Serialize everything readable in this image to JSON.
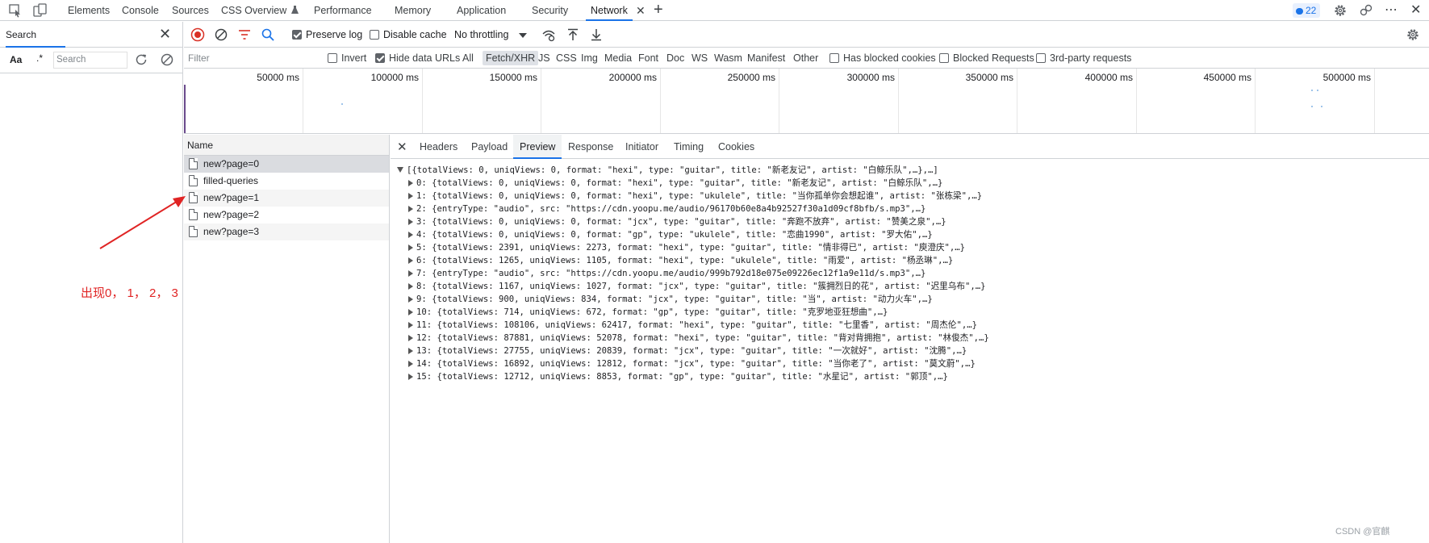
{
  "tabs": {
    "elements": "Elements",
    "console": "Console",
    "sources": "Sources",
    "css_overview": "CSS Overview",
    "css_overview_icon": "flask-icon",
    "performance": "Performance",
    "memory": "Memory",
    "application": "Application",
    "security": "Security",
    "network": "Network",
    "active": "Network",
    "issues_count": "22"
  },
  "search_drawer": {
    "title": "Search",
    "placeholder": "Search",
    "match_case_label": "Aa",
    "regex_label": ".*"
  },
  "toolbar": {
    "preserve_log": "Preserve log",
    "preserve_log_checked": true,
    "disable_cache": "Disable cache",
    "disable_cache_checked": false,
    "throttling": "No throttling"
  },
  "filter": {
    "placeholder": "Filter",
    "invert": "Invert",
    "hide_data_urls": "Hide data URLs",
    "hide_data_urls_checked": true,
    "types": [
      "All",
      "Fetch/XHR",
      "JS",
      "CSS",
      "Img",
      "Media",
      "Font",
      "Doc",
      "WS",
      "Wasm",
      "Manifest",
      "Other"
    ],
    "active_type": "Fetch/XHR",
    "blocked_cookies": "Has blocked cookies",
    "blocked_requests": "Blocked Requests",
    "third_party": "3rd-party requests"
  },
  "timeline": {
    "labels": [
      "50000 ms",
      "100000 ms",
      "150000 ms",
      "200000 ms",
      "250000 ms",
      "300000 ms",
      "350000 ms",
      "400000 ms",
      "450000 ms",
      "500000 ms"
    ]
  },
  "requests": {
    "header": "Name",
    "rows": [
      "new?page=0",
      "filled-queries",
      "new?page=1",
      "new?page=2",
      "new?page=3"
    ]
  },
  "detail": {
    "tabs": [
      "Headers",
      "Payload",
      "Preview",
      "Response",
      "Initiator",
      "Timing",
      "Cookies"
    ],
    "active_tab": "Preview",
    "root_summary": "[{totalViews: 0, uniqViews: 0, format: \"hexi\", type: \"guitar\", title: \"新老友记\", artist: \"白鲸乐队\",…},…]",
    "items": [
      "0: {totalViews: 0, uniqViews: 0, format: \"hexi\", type: \"guitar\", title: \"新老友记\", artist: \"白鲸乐队\",…}",
      "1: {totalViews: 0, uniqViews: 0, format: \"hexi\", type: \"ukulele\", title: \"当你孤单你会想起谁\", artist: \"张栋梁\",…}",
      "2: {entryType: \"audio\", src: \"https://cdn.yoopu.me/audio/96170b60e8a4b92527f30a1d09cf8bfb/s.mp3\",…}",
      "3: {totalViews: 0, uniqViews: 0, format: \"jcx\", type: \"guitar\", title: \"奔跑不放弃\", artist: \"赞美之泉\",…}",
      "4: {totalViews: 0, uniqViews: 0, format: \"gp\", type: \"ukulele\", title: \"恋曲1990\", artist: \"罗大佑\",…}",
      "5: {totalViews: 2391, uniqViews: 2273, format: \"hexi\", type: \"guitar\", title: \"情非得已\", artist: \"庾澄庆\",…}",
      "6: {totalViews: 1265, uniqViews: 1105, format: \"hexi\", type: \"ukulele\", title: \"雨爱\", artist: \"杨丞琳\",…}",
      "7: {entryType: \"audio\", src: \"https://cdn.yoopu.me/audio/999b792d18e075e09226ec12f1a9e11d/s.mp3\",…}",
      "8: {totalViews: 1167, uniqViews: 1027, format: \"jcx\", type: \"guitar\", title: \"簇拥烈日的花\", artist: \"迟里乌布\",…}",
      "9: {totalViews: 900, uniqViews: 834, format: \"jcx\", type: \"guitar\", title: \"当\", artist: \"动力火车\",…}",
      "10: {totalViews: 714, uniqViews: 672, format: \"gp\", type: \"guitar\", title: \"克罗地亚狂想曲\",…}",
      "11: {totalViews: 108106, uniqViews: 62417, format: \"hexi\", type: \"guitar\", title: \"七里香\", artist: \"周杰伦\",…}",
      "12: {totalViews: 87881, uniqViews: 52078, format: \"hexi\", type: \"guitar\", title: \"背对背拥抱\", artist: \"林俊杰\",…}",
      "13: {totalViews: 27755, uniqViews: 20839, format: \"jcx\", type: \"guitar\", title: \"一次就好\", artist: \"沈腾\",…}",
      "14: {totalViews: 16892, uniqViews: 12812, format: \"jcx\", type: \"guitar\", title: \"当你老了\", artist: \"莫文蔚\",…}",
      "15: {totalViews: 12712, uniqViews: 8853, format: \"gp\", type: \"guitar\", title: \"水星记\", artist: \"郭顶\",…}"
    ]
  },
  "annotation": {
    "text": "出现0， 1， 2， 3",
    "color": "#e02424"
  },
  "watermark": "CSDN @官麒",
  "colors": {
    "accent": "#1a73e8",
    "record_red": "#d93025"
  }
}
